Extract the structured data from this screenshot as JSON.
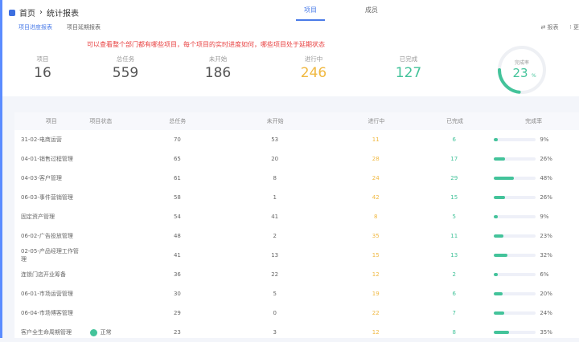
{
  "breadcrumb": {
    "home": "首页",
    "current": "统计报表"
  },
  "tabs": [
    {
      "label": "项目",
      "active": true
    },
    {
      "label": "成员",
      "active": false
    }
  ],
  "subtabs": [
    {
      "label": "项目进度报表",
      "active": true
    },
    {
      "label": "项目延期报表",
      "active": false
    }
  ],
  "tools": {
    "report": "报表",
    "more": "更"
  },
  "annotation": "可以查看整个部门都有哪些项目，每个项目的实时进度如何，哪些项目处于延期状态",
  "stats": [
    {
      "label": "项目",
      "value": "16",
      "color": "#555555"
    },
    {
      "label": "总任务",
      "value": "559",
      "color": "#555555"
    },
    {
      "label": "未开始",
      "value": "186",
      "color": "#555555"
    },
    {
      "label": "进行中",
      "value": "246",
      "color": "#f0b840"
    },
    {
      "label": "已完成",
      "value": "127",
      "color": "#43c39a"
    }
  ],
  "gauge": {
    "label": "完成率",
    "value": "23",
    "unit": "%",
    "percent": 23
  },
  "table": {
    "headers": [
      "项目",
      "项目状态",
      "总任务",
      "未开始",
      "进行中",
      "已完成",
      "完成率"
    ],
    "rows": [
      {
        "name": "31-02-电商运营",
        "status": "",
        "total": "70",
        "todo": "53",
        "doing": "11",
        "done": "6",
        "rate": 9
      },
      {
        "name": "04-01-销售过程管理",
        "status": "",
        "total": "65",
        "todo": "20",
        "doing": "28",
        "done": "17",
        "rate": 26
      },
      {
        "name": "04-03-客户管理",
        "status": "",
        "total": "61",
        "todo": "8",
        "doing": "24",
        "done": "29",
        "rate": 48
      },
      {
        "name": "06-03-事件营销管理",
        "status": "",
        "total": "58",
        "todo": "1",
        "doing": "42",
        "done": "15",
        "rate": 26
      },
      {
        "name": "固定资产管理",
        "status": "",
        "total": "54",
        "todo": "41",
        "doing": "8",
        "done": "5",
        "rate": 9
      },
      {
        "name": "06-02-广告投放管理",
        "status": "",
        "total": "48",
        "todo": "2",
        "doing": "35",
        "done": "11",
        "rate": 23
      },
      {
        "name": "02-05-产品经理工作管理",
        "status": "",
        "total": "41",
        "todo": "13",
        "doing": "15",
        "done": "13",
        "rate": 32
      },
      {
        "name": "连锁门店开业筹备",
        "status": "",
        "total": "36",
        "todo": "22",
        "doing": "12",
        "done": "2",
        "rate": 6
      },
      {
        "name": "06-01-市场运营管理",
        "status": "",
        "total": "30",
        "todo": "5",
        "doing": "19",
        "done": "6",
        "rate": 20
      },
      {
        "name": "06-04-市场博客管理",
        "status": "",
        "total": "29",
        "todo": "0",
        "doing": "22",
        "done": "7",
        "rate": 24
      },
      {
        "name": "客户全生命周期管理",
        "status": "正常",
        "total": "23",
        "todo": "3",
        "doing": "12",
        "done": "8",
        "rate": 35
      }
    ]
  }
}
